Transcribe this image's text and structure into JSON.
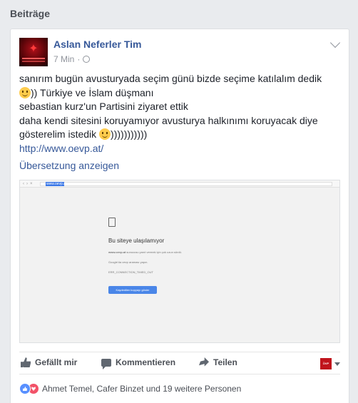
{
  "section": {
    "title": "Beiträge"
  },
  "post": {
    "author": "Aslan Neferler Tim",
    "time": "7 Min",
    "separator": "·",
    "avatar_icon": "wolf-logo-icon",
    "text_lines": [
      "sanırım bugün avusturyada seçim günü bizde seçime katılalım dedik",
      ")) Türkiye ve İslam düşmanı",
      "sebastian kurz'un Partisini ziyaret ettik",
      "daha kendi sitesini koruyamıyor avusturya halkınımı koruyacak diye",
      "gösterelim istedik",
      ")))))))))))"
    ],
    "link": "http://www.oevp.at/",
    "translate_label": "Übersetzung anzeigen"
  },
  "screenshot": {
    "url": "www.oevp.at",
    "error_title": "Bu siteye ulaşılamıyor",
    "error_desc_bold": "www.oevp.at",
    "error_desc": " sunucusu yanıt vermek için çok uzun sürdü.",
    "error_suggest": "Google'da oevp araması yapın.",
    "error_code": "ERR_CONNECTION_TIMED_OUT",
    "button_label": "Kaydedilen kopyayı göster"
  },
  "actions": {
    "like": "Gefällt mir",
    "comment": "Kommentieren",
    "share": "Teilen",
    "page_thumb_text": "ÖVP"
  },
  "reactions": {
    "summary": "Ahmet Temel, Cafer Binzet und 19 weitere Personen"
  },
  "colors": {
    "link": "#365899",
    "like_reaction": "#5890ff",
    "love_reaction": "#f25268"
  }
}
